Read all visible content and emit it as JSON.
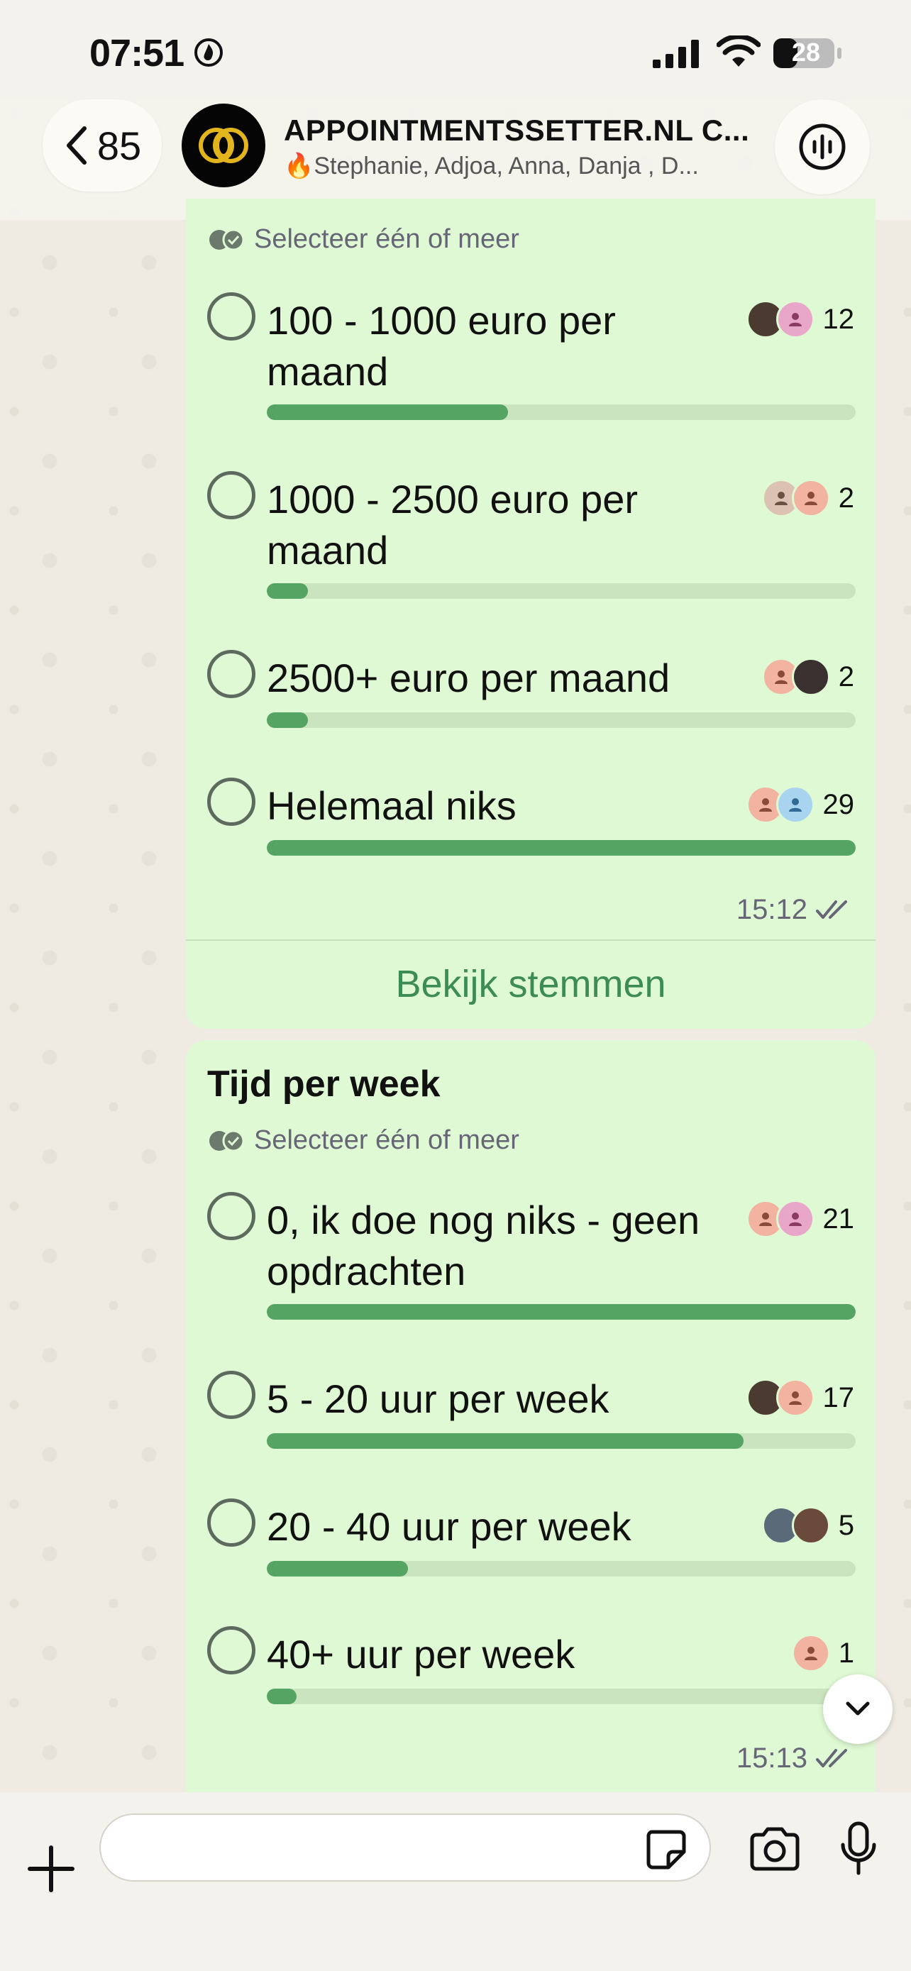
{
  "status_bar": {
    "time": "07:51",
    "battery": "28"
  },
  "header": {
    "back_count": "85",
    "group_name": "APPOINTMENTSSETTER.NL C...",
    "members": "🔥Stephanie, Adjoa, Anna, Danja , D..."
  },
  "colors": {
    "bubble": "#dff9d4",
    "bar_fill": "#55a463",
    "bar_track": "#c9e4bf",
    "accent_text": "#3d8b55"
  },
  "poll1": {
    "hint": "Selecteer één of meer",
    "options": [
      {
        "label": "100 - 1000 euro per maand",
        "count": "12",
        "fraction": 0.41
      },
      {
        "label": "1000 - 2500 euro per maand",
        "count": "2",
        "fraction": 0.07
      },
      {
        "label": "2500+ euro per maand",
        "count": "2",
        "fraction": 0.07
      },
      {
        "label": "Helemaal niks",
        "count": "29",
        "fraction": 1.0
      }
    ],
    "time": "15:12",
    "view_votes": "Bekijk stemmen"
  },
  "poll2": {
    "title": "Tijd per week",
    "hint": "Selecteer één of meer",
    "options": [
      {
        "label": "0, ik doe nog niks - geen opdrachten",
        "count": "21",
        "fraction": 1.0
      },
      {
        "label": "5 - 20 uur per week",
        "count": "17",
        "fraction": 0.81
      },
      {
        "label": "20 - 40 uur per week",
        "count": "5",
        "fraction": 0.24
      },
      {
        "label": "40+ uur per week",
        "count": "1",
        "fraction": 0.05
      }
    ],
    "time": "15:13"
  },
  "input": {
    "placeholder": ""
  }
}
